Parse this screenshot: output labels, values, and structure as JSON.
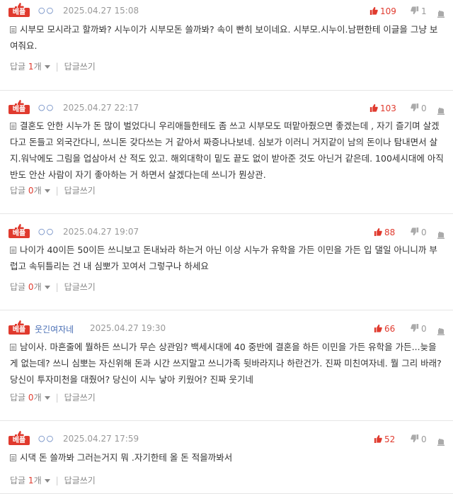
{
  "best_label": "베플",
  "colors": {
    "accent": "#e03a2e",
    "nick": "#4a6fb5",
    "muted": "#999999"
  },
  "comments": [
    {
      "nick": "○○",
      "date": "2025.04.27 15:08",
      "likes": "109",
      "dislikes": "1",
      "text": "시부모 모시라고 할까봐? 시누이가 시부모돈 쓸까봐? 속이 빤히 보이네요. 시부모.시누이.남편한테 이글을 그냥 보여줘요.",
      "reply_label": "답글",
      "reply_count": "1",
      "reply_unit": "개",
      "write_label": "답글쓰기"
    },
    {
      "nick": "○○",
      "date": "2025.04.27 22:17",
      "likes": "103",
      "dislikes": "0",
      "text": "결혼도 안한 시누가 돈 많이 벌었다니 우리애들한테도 좀 쓰고 시부모도 떠맡아줬으면 좋겠는데 , 자기 즐기며 살겠다고 돈들고 외국간다니, 쓰니돈 갖다쓰는 거 같아서 짜증나나보네. 심보가 이러니 거지같이 남의 돈이나 탐내면서 살지.워낙에도 그림을 업삼아서 산 적도 있고. 해외대학이 밑도 끝도 없이 받아준 것도 아닌거 같은데. 100세시대에 아직 반도 안산 사람이 자기 좋아하는 거 하면서 살겠다는데 쓰니가 뭔상관.",
      "reply_label": "답글",
      "reply_count": "0",
      "reply_unit": "개",
      "write_label": "답글쓰기"
    },
    {
      "nick": "○○",
      "date": "2025.04.27 19:07",
      "likes": "88",
      "dislikes": "0",
      "text": "나이가 40이든 50이든 쓰니보고 돈내놔라 하는거 아닌 이상 시누가 유학을 가든 이민을 가든 입 댈일 아니니까 부럽고 속뒤틀리는 건 내 심뽀가 꼬여서 그렇구나 하세요",
      "reply_label": "답글",
      "reply_count": "0",
      "reply_unit": "개",
      "write_label": "답글쓰기"
    },
    {
      "nick": "웃긴여자네",
      "date": "2025.04.27 19:30",
      "likes": "66",
      "dislikes": "0",
      "text": "남이사. 마흔줄에 뭘하든 쓰니가 무슨 상관임? 백세시대에 40 중반에 결혼을 하든 이민을 가든 유학을 가든...늦을게 없는데? 쓰니 심뽀는 자신위해 돈과 시간 쓰지말고 쓰니가족 뒷바라지나 하란건가. 진짜 미친여자네. 뭘 그리 바래? 당신이 투자미천을 대줬어? 당신이 시누 낳아 키웠어? 진짜 웃기네",
      "reply_label": "답글",
      "reply_count": "0",
      "reply_unit": "개",
      "write_label": "답글쓰기"
    },
    {
      "nick": "○○",
      "date": "2025.04.27 17:59",
      "likes": "52",
      "dislikes": "0",
      "text": "시댁 돈 쓸까봐 그러는거지 뭐 .자기한테 올 돈 적을까봐서",
      "reply_label": "답글",
      "reply_count": "1",
      "reply_unit": "개",
      "write_label": "답글쓰기"
    }
  ]
}
